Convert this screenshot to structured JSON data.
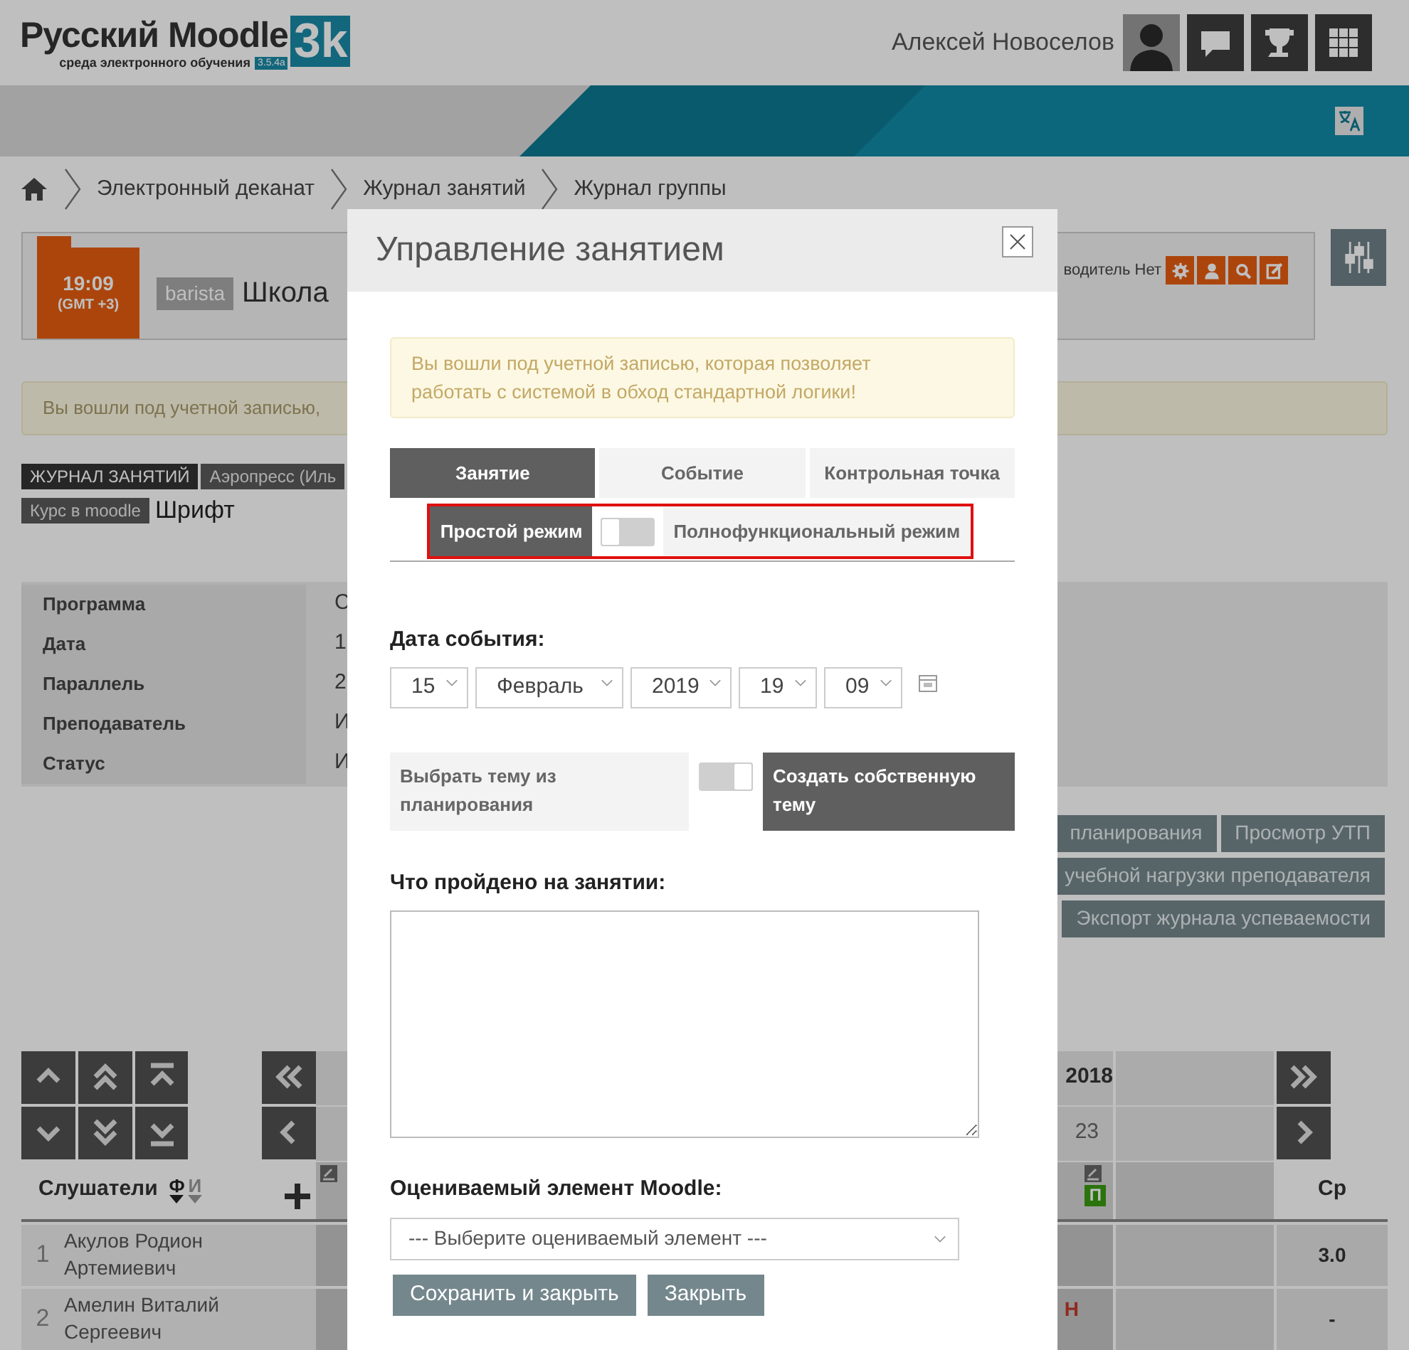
{
  "header": {
    "logo": {
      "title": "Русский Moodle",
      "mark": "3k",
      "subtitle": "среда электронного обучения",
      "version": "3.5.4a"
    },
    "user_name": "Алексей Новоселов"
  },
  "breadcrumb": [
    "Электронный деканат",
    "Журнал занятий",
    "Журнал группы"
  ],
  "lesson_card": {
    "time": "19:09",
    "timezone": "(GMT +3)",
    "tag": "barista",
    "title": "Школа",
    "supervisor": "водитель Нет"
  },
  "alert": "Вы вошли под учетной записью,",
  "tags": [
    {
      "label": "ЖУРНАЛ ЗАНЯТИЙ",
      "kind": "dark"
    },
    {
      "label": "Аэропресс (Иль",
      "kind": "gray"
    }
  ],
  "course": {
    "label": "Курс в moodle",
    "value": "Шрифт"
  },
  "info": [
    {
      "label": "Программа",
      "value": "С"
    },
    {
      "label": "Дата",
      "value": "1"
    },
    {
      "label": "Параллель",
      "value": "2"
    },
    {
      "label": "Преподаватель",
      "value": "И"
    },
    {
      "label": "Статус",
      "value": "И"
    }
  ],
  "action_buttons": [
    [
      "планирования",
      "Просмотр УТП"
    ],
    [
      "учебной нагрузки преподавателя"
    ],
    [
      "Экспорт журнала успеваемости"
    ]
  ],
  "journal": {
    "month": "2018",
    "days": [
      "23"
    ],
    "students_header": "Слушатели",
    "sort": [
      {
        "label": "Ф",
        "selected": true
      },
      {
        "label": "И",
        "selected": false
      }
    ],
    "attendance_mark": "П",
    "average_header": "Ср",
    "rows": [
      {
        "number": "1",
        "name": "Акулов Родион Артемиевич",
        "average": "3.0"
      },
      {
        "number": "2",
        "name": "Амелин Виталий Сергеевич",
        "mark": "Н",
        "average": "-"
      }
    ]
  },
  "modal": {
    "title": "Управление занятием",
    "notice": "Вы вошли под учетной записью, которая позволяет работать с системой в обход стандартной логики!",
    "tabs": [
      {
        "label": "Занятие",
        "selected": true
      },
      {
        "label": "Событие",
        "selected": false
      },
      {
        "label": "Контрольная точка",
        "selected": false
      }
    ],
    "modes": [
      {
        "label": "Простой режим",
        "selected": true
      },
      {
        "label": "Полнофункциональный режим",
        "selected": false
      }
    ],
    "mode_toggle": {
      "on": false
    },
    "topic_toggle": {
      "on": true
    },
    "date_label": "Дата события:",
    "date_fields": [
      "15",
      "Февраль",
      "2019",
      "19",
      "09"
    ],
    "topic_options": [
      {
        "label": "Выбрать тему из планирования",
        "selected": false
      },
      {
        "label": "Создать собственную тему",
        "selected": true
      }
    ],
    "covered_label": "Что пройдено на занятии:",
    "grade_label": "Оцениваемый элемент Moodle:",
    "grade_select": "--- Выберите оцениваемый элемент ---",
    "buttons": [
      "Сохранить и закрыть",
      "Закрыть"
    ]
  }
}
